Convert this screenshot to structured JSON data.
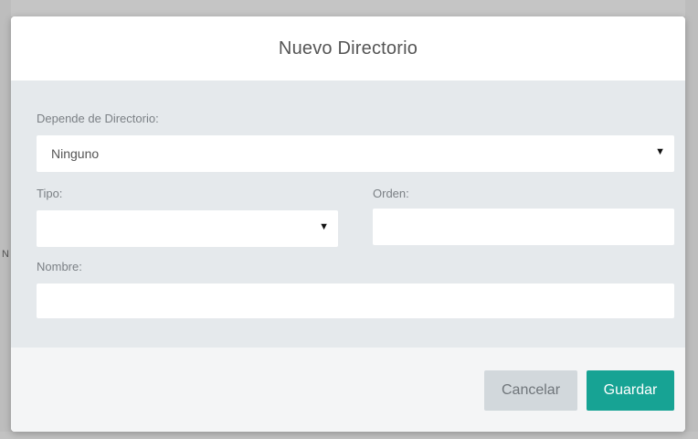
{
  "dialog": {
    "title": "Nuevo Directorio"
  },
  "form": {
    "parent_directory": {
      "label": "Depende de Directorio:",
      "value": "Ninguno"
    },
    "type": {
      "label": "Tipo:",
      "value": ""
    },
    "order": {
      "label": "Orden:",
      "value": ""
    },
    "name": {
      "label": "Nombre:",
      "value": ""
    }
  },
  "footer": {
    "cancel_label": "Cancelar",
    "save_label": "Guardar"
  },
  "backdrop": {
    "partial_glyph": "N"
  },
  "icons": {
    "select_caret": "chevron-down-icon"
  },
  "colors": {
    "primary": "#17a394",
    "body_bg": "#e5e9ec",
    "footer_bg": "#f4f5f6"
  }
}
